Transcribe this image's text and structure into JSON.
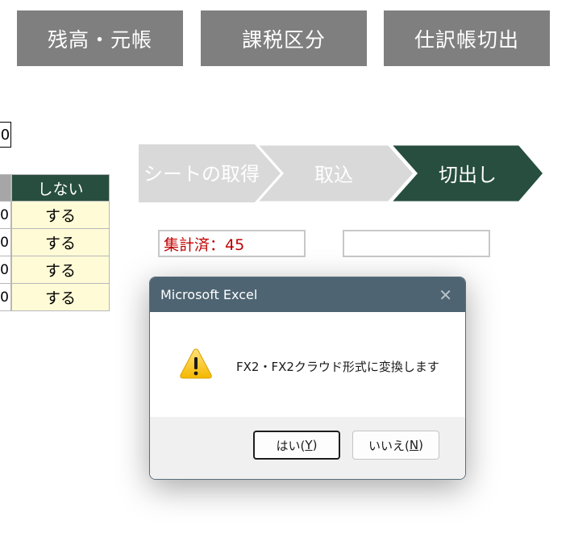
{
  "toolbar": {
    "balance_label": "残高・元帳",
    "tax_label": "課税区分",
    "journal_label": "仕訳帳切出"
  },
  "cell_value": "0",
  "table": {
    "header": "しない",
    "rows": [
      {
        "left": "0",
        "value": "する"
      },
      {
        "left": "0",
        "value": "する"
      },
      {
        "left": "0",
        "value": "する"
      },
      {
        "left": "0",
        "value": "する"
      }
    ]
  },
  "steps": {
    "items": [
      "シートの取得",
      "取込",
      "切出し"
    ],
    "inactive_color": "#d9d9d9",
    "active_color": "#274e3e"
  },
  "fields": {
    "count_text": "集計済：45",
    "empty_value": ""
  },
  "dialog": {
    "title": "Microsoft Excel",
    "close": "✕",
    "message": "FX2・FX2クラウド形式に変換します",
    "yes_label": "はい(",
    "yes_key": "Y",
    "no_label": "いいえ(",
    "no_key": "N",
    "paren_close": ")",
    "icon": "warning-icon"
  },
  "colors": {
    "toolbar_bg": "#7f7f7f",
    "dialog_title_bg": "#4e6472",
    "count_text": "#c00000"
  }
}
